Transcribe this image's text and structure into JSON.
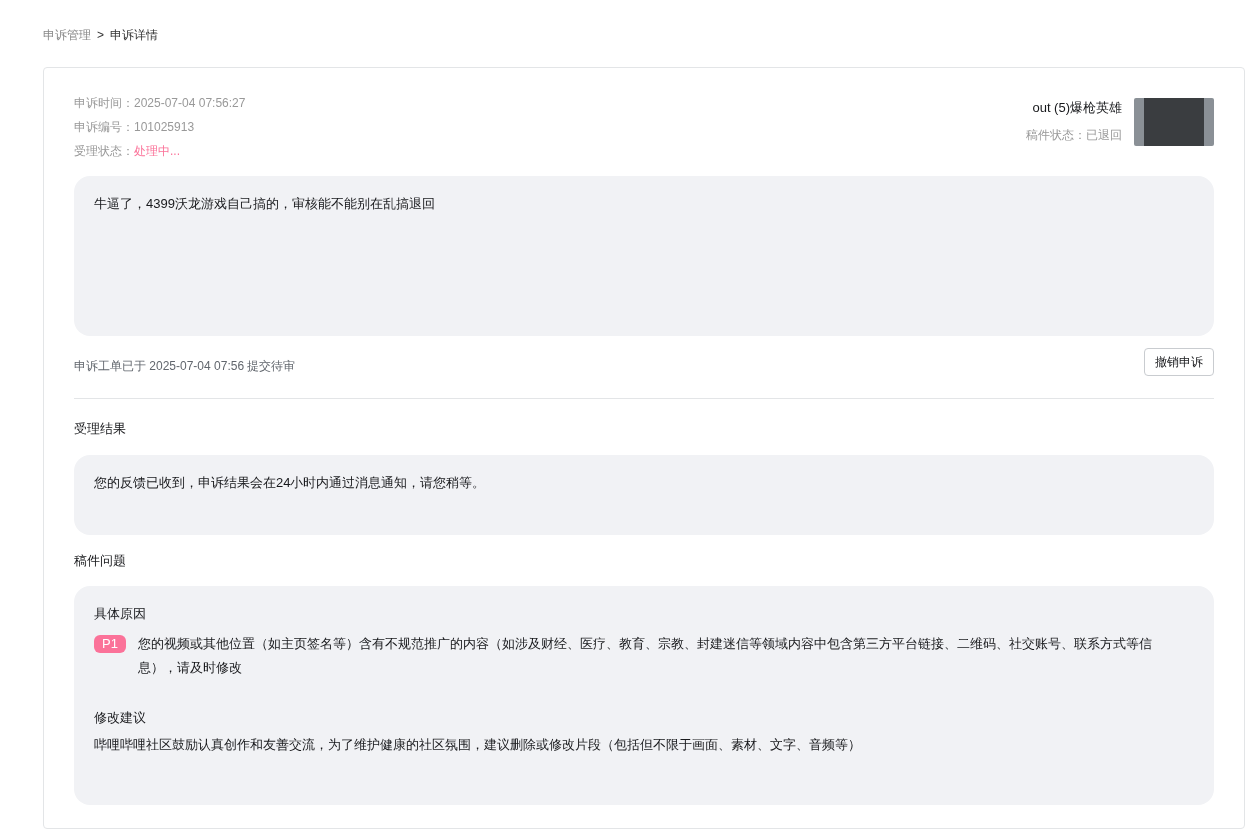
{
  "breadcrumb": {
    "items": [
      {
        "label": "申诉管理"
      },
      {
        "label": "申诉详情"
      }
    ],
    "separator": ">"
  },
  "appeal": {
    "time_label": "申诉时间：",
    "time": "2025-07-04 07:56:27",
    "number_label": "申诉编号：",
    "number": "101025913",
    "status_label": "受理状态：",
    "status": "处理中..."
  },
  "video": {
    "title": "out (5)爆枪英雄",
    "status_label": "稿件状态：",
    "status": "已退回"
  },
  "appeal_text": "牛逼了，4399沃龙游戏自己搞的，审核能不能别在乱搞退回",
  "submitted_note": "申诉工单已于 2025-07-04 07:56 提交待审",
  "withdraw_button": "撤销申诉",
  "result": {
    "heading": "受理结果",
    "text": "您的反馈已收到，申诉结果会在24小时内通过消息通知，请您稍等。"
  },
  "issue": {
    "heading": "稿件问题",
    "reason_heading": "具体原因",
    "priority": "P1",
    "reason": "您的视频或其他位置（如主页签名等）含有不规范推广的内容（如涉及财经、医疗、教育、宗教、封建迷信等领域内容中包含第三方平台链接、二维码、社交账号、联系方式等信息），请及时修改",
    "suggestion_heading": "修改建议",
    "suggestion": "哔哩哔哩社区鼓励认真创作和友善交流，为了维护健康的社区氛围，建议删除或修改片段（包括但不限于画面、素材、文字、音频等）"
  }
}
